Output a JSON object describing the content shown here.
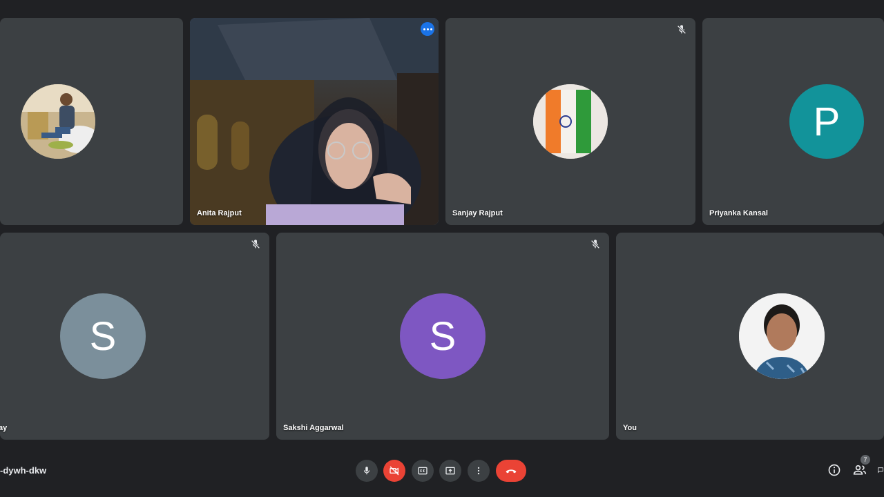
{
  "participants": {
    "tile1": {
      "name": ""
    },
    "tile2": {
      "name": "Anita Rajput"
    },
    "tile3": {
      "name": "Sanjay Rajput"
    },
    "tile4": {
      "name": "Priyanka Kansal",
      "initial": "P",
      "color": "#12939a"
    },
    "tile5": {
      "name": "ay",
      "initial": "S",
      "color": "#7b8f9b"
    },
    "tile6": {
      "name": "Sakshi Aggarwal",
      "initial": "S",
      "color": "#7e57c2"
    },
    "tile7": {
      "name": "You"
    }
  },
  "toolbar": {
    "meeting_code": "-dywh-dkw",
    "people_count": "7"
  },
  "colors": {
    "background": "#202124",
    "tile": "#3c4043",
    "speaking_outline": "#8ab4f8",
    "danger": "#ea4335"
  }
}
